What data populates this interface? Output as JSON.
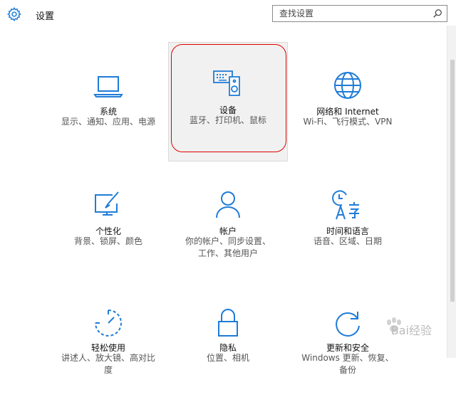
{
  "header": {
    "title": "设置",
    "gear_icon": "gear-icon",
    "search_placeholder": "查找设置",
    "search_value": ""
  },
  "accent_color": "#1f7cd8",
  "tiles": [
    {
      "id": "system",
      "name": "系统",
      "desc": "显示、通知、应用、电源",
      "icon": "laptop-icon"
    },
    {
      "id": "devices",
      "name": "设备",
      "desc": "蓝牙、打印机、鼠标",
      "icon": "keyboard-speaker-icon",
      "highlighted": true
    },
    {
      "id": "network",
      "name": "网络和 Internet",
      "desc": "Wi-Fi、飞行模式、VPN",
      "icon": "globe-icon"
    },
    {
      "id": "personalization",
      "name": "个性化",
      "desc": "背景、锁屏、颜色",
      "icon": "paint-screen-icon"
    },
    {
      "id": "accounts",
      "name": "帐户",
      "desc": "你的帐户、同步设置、工作、其他用户",
      "icon": "person-icon"
    },
    {
      "id": "time_language",
      "name": "时间和语言",
      "desc": "语音、区域、日期",
      "icon": "time-language-icon"
    },
    {
      "id": "ease",
      "name": "轻松使用",
      "desc": "讲述人、放大镜、高对比度",
      "icon": "timer-icon"
    },
    {
      "id": "privacy",
      "name": "隐私",
      "desc": "位置、相机",
      "icon": "lock-icon"
    },
    {
      "id": "update",
      "name": "更新和安全",
      "desc": "Windows 更新、恢复、备份",
      "icon": "refresh-icon"
    }
  ],
  "watermark": "Bai经验"
}
